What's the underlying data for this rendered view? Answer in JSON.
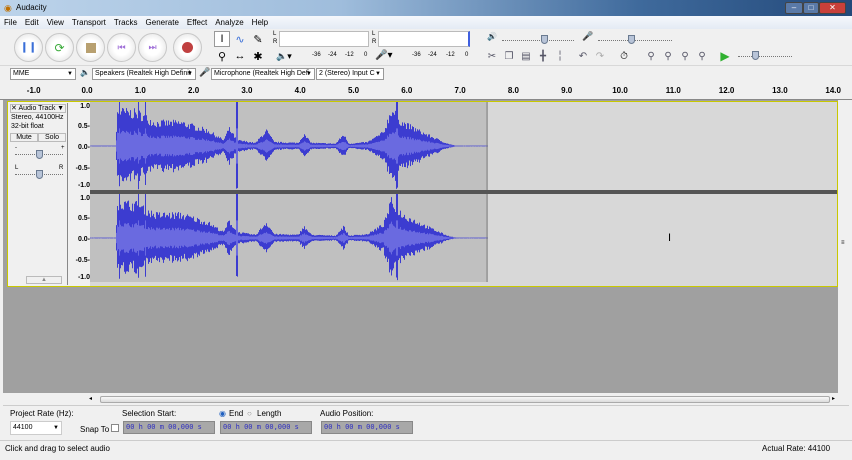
{
  "window": {
    "title": "Audacity",
    "controls": [
      "minimize",
      "maximize",
      "close"
    ]
  },
  "menu": [
    "File",
    "Edit",
    "View",
    "Transport",
    "Tracks",
    "Generate",
    "Effect",
    "Analyze",
    "Help"
  ],
  "transport": [
    {
      "name": "pause",
      "icon": "pause-icon",
      "color": "#3a6fd8"
    },
    {
      "name": "play",
      "icon": "loop-play-icon",
      "color": "#3aaa3a"
    },
    {
      "name": "stop",
      "icon": "stop-icon",
      "color": "#b8a070"
    },
    {
      "name": "skip-start",
      "icon": "skip-start-icon",
      "color": "#a070d8"
    },
    {
      "name": "skip-end",
      "icon": "skip-end-icon",
      "color": "#a070d8"
    },
    {
      "name": "record",
      "icon": "record-icon",
      "color": "#c04040"
    }
  ],
  "meters": {
    "play_ticks": [
      "-36",
      "-24",
      "-12",
      "0"
    ],
    "rec_ticks": [
      "-36",
      "-24",
      "-12",
      "0"
    ],
    "L": "L",
    "R": "R"
  },
  "device": {
    "host": "MME",
    "output": "Speakers (Realtek High Definit",
    "input": "Microphone (Realtek High Defi",
    "channels": "2 (Stereo) Input C"
  },
  "ruler": {
    "ticks": [
      "-1.0",
      "0.0",
      "1.0",
      "2.0",
      "3.0",
      "4.0",
      "5.0",
      "6.0",
      "7.0",
      "8.0",
      "9.0",
      "10.0",
      "11.0",
      "12.0",
      "13.0",
      "14.0"
    ]
  },
  "track": {
    "name": "Audio Track",
    "info1": "Stereo, 44100Hz",
    "info2": "32-bit float",
    "mute": "Mute",
    "solo": "Solo",
    "gain_minus": "-",
    "gain_plus": "+",
    "pan_l": "L",
    "pan_r": "R",
    "scale": [
      "1.0",
      "0.5-",
      "0.0-",
      "-0.5-",
      "-1.0"
    ],
    "wave_color": "#3c3cd0",
    "duration_s": 7.45
  },
  "selection": {
    "project_rate_label": "Project Rate (Hz):",
    "project_rate": "44100",
    "snap_to": "Snap To",
    "selection_start": "Selection Start:",
    "end_label": "End",
    "length_label": "Length",
    "audio_position": "Audio Position:",
    "start_time": "00 h 00 m 00,000 s",
    "end_time": "00 h 00 m 00,000 s",
    "pos_time": "00 h 00 m 00,000 s"
  },
  "status": {
    "left": "Click and drag to select audio",
    "right": "Actual Rate: 44100"
  }
}
